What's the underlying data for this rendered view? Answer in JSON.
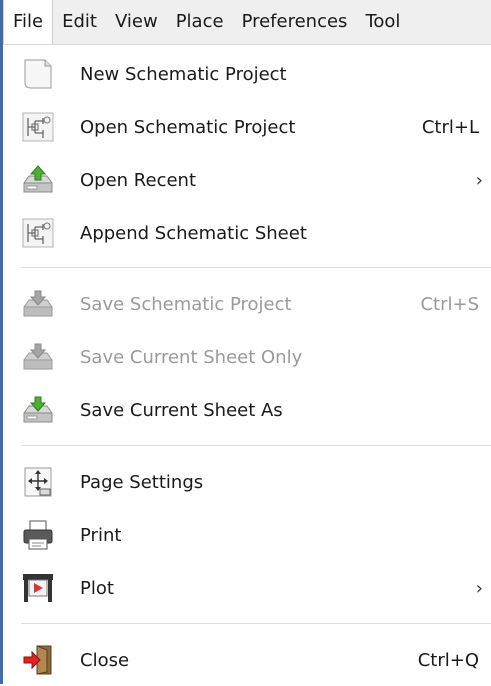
{
  "menubar": {
    "items": [
      "File",
      "Edit",
      "View",
      "Place",
      "Preferences",
      "Tool"
    ]
  },
  "file_menu": {
    "items": [
      {
        "label": "New Schematic Project",
        "shortcut": "",
        "icon": "new-document-icon",
        "enabled": true,
        "submenu": false
      },
      {
        "label": "Open Schematic Project",
        "shortcut": "Ctrl+L",
        "icon": "open-schematic-icon",
        "enabled": true,
        "submenu": false
      },
      {
        "label": "Open Recent",
        "shortcut": "",
        "icon": "open-recent-icon",
        "enabled": true,
        "submenu": true
      },
      {
        "label": "Append Schematic Sheet",
        "shortcut": "",
        "icon": "append-sheet-icon",
        "enabled": true,
        "submenu": false
      },
      {
        "label": "Save Schematic Project",
        "shortcut": "Ctrl+S",
        "icon": "save-project-icon",
        "enabled": false,
        "submenu": false
      },
      {
        "label": "Save Current Sheet Only",
        "shortcut": "",
        "icon": "save-sheet-icon",
        "enabled": false,
        "submenu": false
      },
      {
        "label": "Save Current Sheet As",
        "shortcut": "",
        "icon": "save-as-icon",
        "enabled": true,
        "submenu": false
      },
      {
        "label": "Page Settings",
        "shortcut": "",
        "icon": "page-settings-icon",
        "enabled": true,
        "submenu": false
      },
      {
        "label": "Print",
        "shortcut": "",
        "icon": "printer-icon",
        "enabled": true,
        "submenu": false
      },
      {
        "label": "Plot",
        "shortcut": "",
        "icon": "plotter-icon",
        "enabled": true,
        "submenu": true
      },
      {
        "label": "Close",
        "shortcut": "Ctrl+Q",
        "icon": "exit-icon",
        "enabled": true,
        "submenu": false
      }
    ],
    "submenu_arrow": "›"
  },
  "colors": {
    "menubar_bg": "#efefef",
    "disabled_text": "#9a9a9a",
    "accent_border": "#3c6fa8"
  }
}
